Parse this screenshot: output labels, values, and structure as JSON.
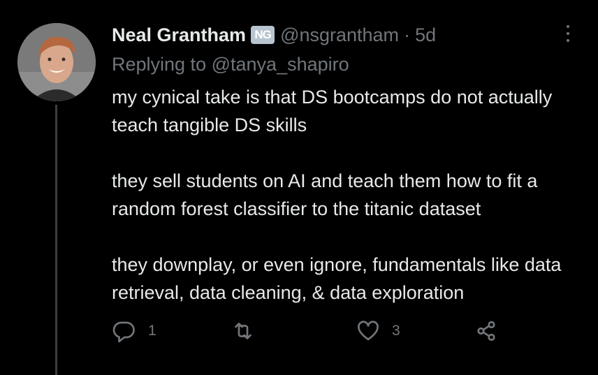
{
  "author": {
    "display_name": "Neal Grantham",
    "badge": "NG",
    "handle": "@nsgrantham",
    "separator": "·",
    "time": "5d"
  },
  "reply": {
    "prefix": "Replying to",
    "mention": "@tanya_shapiro"
  },
  "tweet": {
    "paragraphs": [
      "my cynical take is that DS bootcamps do not actually teach tangible DS skills",
      "they sell students on AI and teach them how to fit a random forest classifier to the titanic dataset",
      "they downplay, or even ignore, fundamentals like data retrieval, data cleaning, & data exploration"
    ]
  },
  "actions": {
    "reply_icon": "reply-icon",
    "reply_count": "1",
    "retweet_icon": "retweet-icon",
    "like_icon": "heart-icon",
    "like_count": "3",
    "share_icon": "share-icon"
  },
  "colors": {
    "background": "#000000",
    "text": "#e7e9ea",
    "muted": "#71767b",
    "thread_line": "#3b3f43"
  }
}
